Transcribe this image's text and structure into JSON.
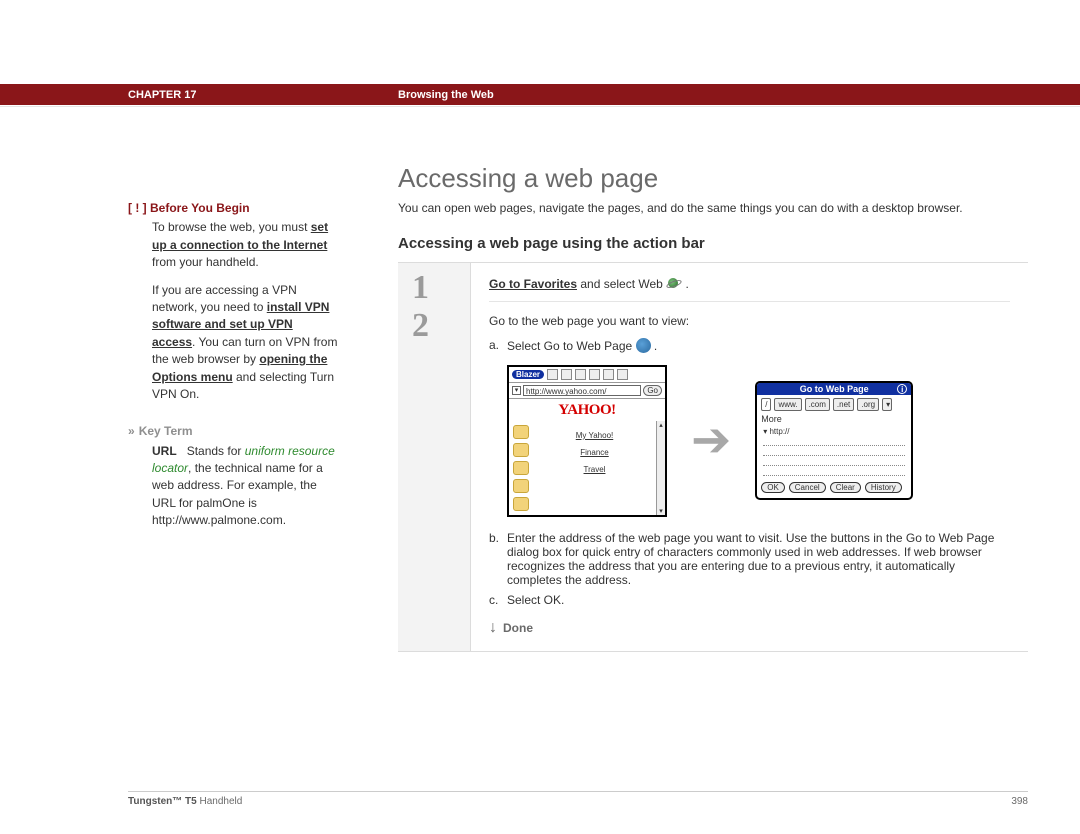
{
  "header": {
    "chapter": "CHAPTER 17",
    "title": "Browsing the Web"
  },
  "sidebar": {
    "byb_marker": "[ ! ]",
    "byb_heading": "Before You Begin",
    "p1_a": "To browse the web, you must ",
    "p1_link": "set up a connection to the Internet",
    "p1_b": " from your handheld.",
    "p2_a": "If you are accessing a VPN network, you need to ",
    "p2_link1": "install VPN software and set up VPN access",
    "p2_b": ". You can turn on VPN from the web browser by ",
    "p2_link2": "opening the Options menu",
    "p2_c": " and selecting Turn VPN On.",
    "kt_chevron": "»",
    "kt_heading": "Key Term",
    "kt_term": "URL",
    "kt_def_em": "uniform resource locator",
    "kt_stands": "Stands for ",
    "kt_rest": ", the technical name for a web address. For example, the URL for palmOne is http://www.palmone.com."
  },
  "main": {
    "h1": "Accessing a web page",
    "intro": "You can open web pages, navigate the pages, and do the same things you can do with a desktop browser.",
    "h2": "Accessing a web page using the action bar",
    "step1_num": "1",
    "step2_num": "2",
    "step1_bold": "Go to Favorites",
    "step1_rest": " and select Web ",
    "step2_lead": "Go to the web page you want to view:",
    "step2_a": "Select Go to Web Page ",
    "step2_b": "Enter the address of the web page you want to visit. Use the buttons in the Go to Web Page dialog box for quick entry of characters commonly used in web addresses. If web browser recognizes the address that you are entering due to a previous entry, it automatically completes the address.",
    "step2_c": "Select OK.",
    "done": "Done"
  },
  "blazer": {
    "name": "Blazer",
    "url": "http://www.yahoo.com/",
    "go": "Go",
    "logo": "YAHOO!",
    "links": [
      "My Yahoo!",
      "Finance",
      "Travel"
    ]
  },
  "dialog": {
    "title": "Go to Web Page",
    "pills": [
      "/",
      "www.",
      ".com",
      ".net",
      ".org"
    ],
    "more": "More",
    "prefix": "http://",
    "buttons": [
      "OK",
      "Cancel",
      "Clear",
      "History"
    ]
  },
  "footer": {
    "product_bold": "Tungsten™ T5",
    "product_rest": " Handheld",
    "page": "398"
  }
}
